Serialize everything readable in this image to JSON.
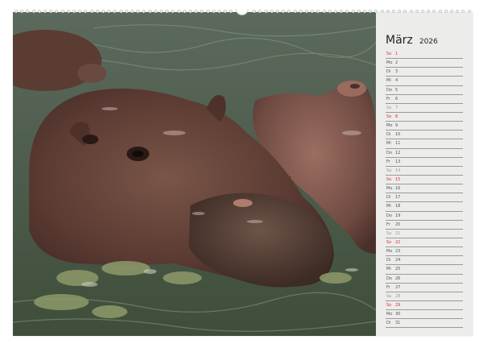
{
  "calendar": {
    "month": "März",
    "year": "2026",
    "days": [
      {
        "wd": "So",
        "n": "1",
        "type": "sun"
      },
      {
        "wd": "Mo",
        "n": "2",
        "type": ""
      },
      {
        "wd": "Di",
        "n": "3",
        "type": ""
      },
      {
        "wd": "Mi",
        "n": "4",
        "type": ""
      },
      {
        "wd": "Do",
        "n": "5",
        "type": ""
      },
      {
        "wd": "Fr",
        "n": "6",
        "type": ""
      },
      {
        "wd": "Sa",
        "n": "7",
        "type": "sat"
      },
      {
        "wd": "So",
        "n": "8",
        "type": "sun"
      },
      {
        "wd": "Mo",
        "n": "9",
        "type": ""
      },
      {
        "wd": "Di",
        "n": "10",
        "type": ""
      },
      {
        "wd": "Mi",
        "n": "11",
        "type": ""
      },
      {
        "wd": "Do",
        "n": "12",
        "type": ""
      },
      {
        "wd": "Fr",
        "n": "13",
        "type": ""
      },
      {
        "wd": "Sa",
        "n": "14",
        "type": "sat"
      },
      {
        "wd": "So",
        "n": "15",
        "type": "sun"
      },
      {
        "wd": "Mo",
        "n": "16",
        "type": ""
      },
      {
        "wd": "Di",
        "n": "17",
        "type": ""
      },
      {
        "wd": "Mi",
        "n": "18",
        "type": ""
      },
      {
        "wd": "Do",
        "n": "19",
        "type": ""
      },
      {
        "wd": "Fr",
        "n": "20",
        "type": ""
      },
      {
        "wd": "Sa",
        "n": "21",
        "type": "sat"
      },
      {
        "wd": "So",
        "n": "22",
        "type": "sun"
      },
      {
        "wd": "Mo",
        "n": "23",
        "type": ""
      },
      {
        "wd": "Di",
        "n": "24",
        "type": ""
      },
      {
        "wd": "Mi",
        "n": "25",
        "type": ""
      },
      {
        "wd": "Do",
        "n": "26",
        "type": ""
      },
      {
        "wd": "Fr",
        "n": "27",
        "type": ""
      },
      {
        "wd": "Sa",
        "n": "28",
        "type": "sat"
      },
      {
        "wd": "So",
        "n": "29",
        "type": "sun"
      },
      {
        "wd": "Mo",
        "n": "30",
        "type": ""
      },
      {
        "wd": "Di",
        "n": "31",
        "type": ""
      }
    ]
  },
  "colors": {
    "sunday": "#d33333",
    "saturday": "#9a9a9a",
    "weekday": "#555555",
    "panel": "#ececeb"
  },
  "photo": {
    "subject": "hippo-photo"
  }
}
